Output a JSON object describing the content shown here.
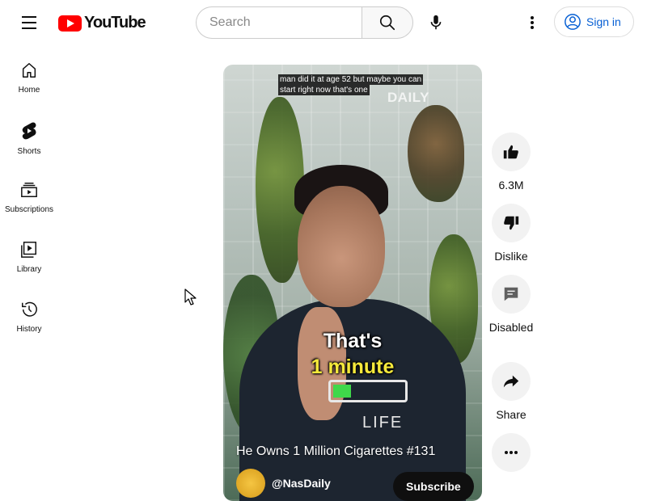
{
  "header": {
    "logo_text": "YouTube",
    "search": {
      "placeholder": "Search",
      "value": ""
    },
    "sign_in_label": "Sign in"
  },
  "sidebar": {
    "items": [
      {
        "label": "Home",
        "icon": "home-icon"
      },
      {
        "label": "Shorts",
        "icon": "shorts-icon"
      },
      {
        "label": "Subscriptions",
        "icon": "subscriptions-icon"
      },
      {
        "label": "Library",
        "icon": "library-icon"
      },
      {
        "label": "History",
        "icon": "history-icon"
      }
    ]
  },
  "short": {
    "caption_line1": "man did it at age 52 but maybe you can",
    "caption_line2": "start right now that's one",
    "watermark": "DAILY",
    "overlay_line1": "That's",
    "overlay_line2": "1 minute",
    "shirt_text": "LIFE",
    "title": "He Owns 1 Million Cigarettes #131",
    "channel": "@NasDaily",
    "subscribe_label": "Subscribe"
  },
  "actions": {
    "like_label": "6.3M",
    "dislike_label": "Dislike",
    "comments_label": "Disabled",
    "share_label": "Share"
  },
  "colors": {
    "brand_red": "#ff0000",
    "link_blue": "#065fd4",
    "action_bg": "#f2f2f2",
    "overlay_yellow": "#f5e93b"
  }
}
